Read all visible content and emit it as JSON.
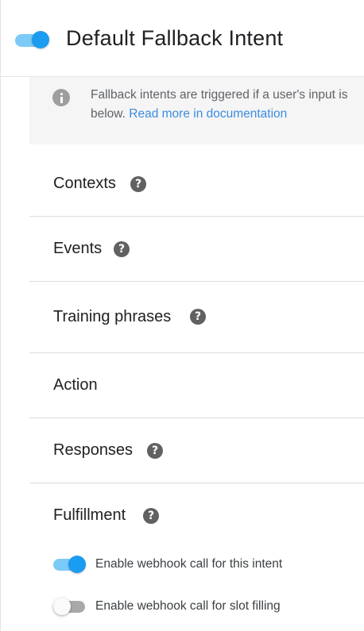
{
  "intent": {
    "title": "Default Fallback Intent",
    "enabled": true
  },
  "info": {
    "line1": "Fallback intents are triggered if a user's input is",
    "line2_prefix": "below. ",
    "link_text": "Read more in documentation"
  },
  "sections": [
    {
      "label": "Contexts",
      "help_glyph": "?"
    },
    {
      "label": "Events",
      "help_glyph": "?"
    },
    {
      "label": "Training phrases",
      "help_glyph": "?"
    },
    {
      "label": "Action"
    },
    {
      "label": "Responses",
      "help_glyph": "?"
    },
    {
      "label": "Fulfillment",
      "help_glyph": "?"
    }
  ],
  "fulfillment": {
    "options": [
      {
        "label": "Enable webhook call for this intent",
        "enabled": true
      },
      {
        "label": "Enable webhook call for slot filling",
        "enabled": false
      }
    ]
  },
  "icons": {
    "info": "info-icon",
    "help": "help-circle-icon",
    "toggle": "toggle-switch-icon"
  },
  "colors": {
    "accent": "#1a9cf0",
    "link": "#3b8de0",
    "info_bg": "#f5f5f5",
    "help_icon": "#616161"
  }
}
